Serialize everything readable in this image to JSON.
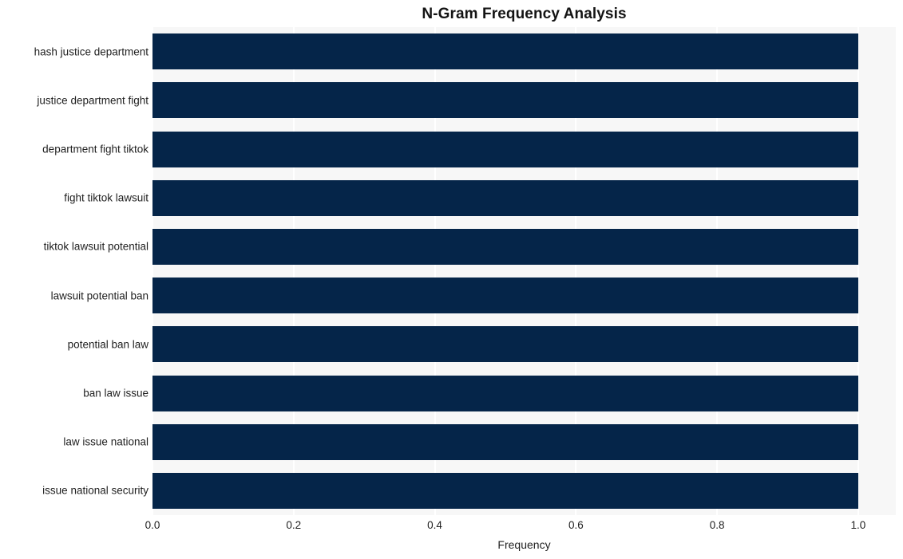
{
  "chart_data": {
    "type": "bar",
    "orientation": "horizontal",
    "title": "N-Gram Frequency Analysis",
    "xlabel": "Frequency",
    "ylabel": "",
    "categories": [
      "hash justice department",
      "justice department fight",
      "department fight tiktok",
      "fight tiktok lawsuit",
      "tiktok lawsuit potential",
      "lawsuit potential ban",
      "potential ban law",
      "ban law issue",
      "law issue national",
      "issue national security"
    ],
    "values": [
      1.0,
      1.0,
      1.0,
      1.0,
      1.0,
      1.0,
      1.0,
      1.0,
      1.0,
      1.0
    ],
    "xlim": [
      0.0,
      1.0533
    ],
    "xticks": [
      0.0,
      0.2,
      0.4,
      0.6,
      0.8,
      1.0
    ],
    "xtick_labels": [
      "0.0",
      "0.2",
      "0.4",
      "0.6",
      "0.8",
      "1.0"
    ],
    "grid": true,
    "grid_axis": "x",
    "legend": null,
    "colors": {
      "bar": "#052549",
      "plot_background": "#f7f7f7",
      "figure_background": "#ffffff",
      "gridline": "#ffffff",
      "text": "#1f1f1f",
      "title_text": "#141414"
    }
  }
}
